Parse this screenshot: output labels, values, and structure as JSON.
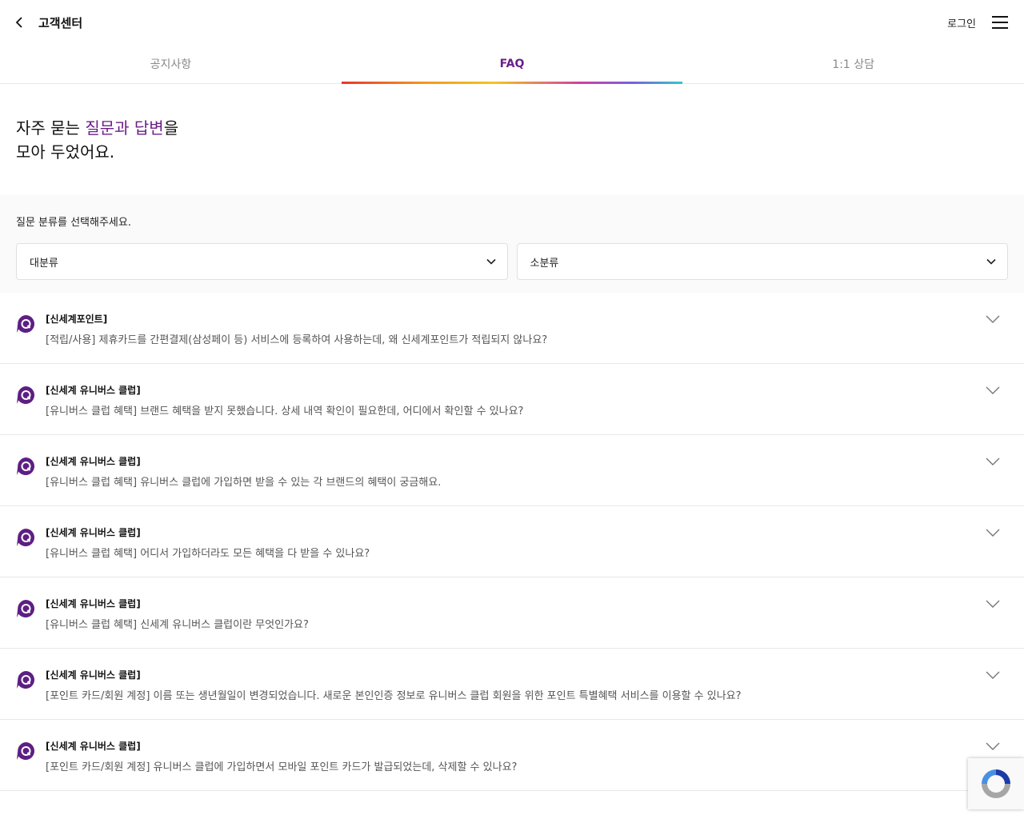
{
  "header": {
    "title": "고객센터",
    "login_label": "로그인"
  },
  "tabs": [
    {
      "label": "공지사항"
    },
    {
      "label": "FAQ"
    },
    {
      "label": "1:1 상담"
    }
  ],
  "intro": {
    "line1_pre": "자주 묻는 ",
    "line1_accent": "질문과 답변",
    "line1_post": "을",
    "line2": "모아 두었어요."
  },
  "filter": {
    "label": "질문 분류를 선택해주세요.",
    "major": "대분류",
    "minor": "소분류"
  },
  "faqs": [
    {
      "category": "[신세계포인트]",
      "question": "[적립/사용] 제휴카드를 간편결제(삼성페이 등) 서비스에 등록하여 사용하는데, 왜 신세계포인트가 적립되지 않나요?"
    },
    {
      "category": "[신세계 유니버스 클럽]",
      "question": "[유니버스 클럽 혜택] 브랜드 혜택을 받지 못했습니다. 상세 내역 확인이 필요한데, 어디에서 확인할 수 있나요?"
    },
    {
      "category": "[신세계 유니버스 클럽]",
      "question": "[유니버스 클럽 혜택] 유니버스 클럽에 가입하면 받을 수 있는 각 브랜드의 혜택이 궁금해요."
    },
    {
      "category": "[신세계 유니버스 클럽]",
      "question": "[유니버스 클럽 혜택] 어디서 가입하더라도 모든 혜택을 다 받을 수 있나요?"
    },
    {
      "category": "[신세계 유니버스 클럽]",
      "question": "[유니버스 클럽 혜택] 신세계 유니버스 클럽이란 무엇인가요?"
    },
    {
      "category": "[신세계 유니버스 클럽]",
      "question": "[포인트 카드/회원 계정] 이름 또는 생년월일이 변경되었습니다. 새로운 본인인증 정보로 유니버스 클럽 회원을 위한 포인트 특별혜택 서비스를 이용할 수 있나요?"
    },
    {
      "category": "[신세계 유니버스 클럽]",
      "question": "[포인트 카드/회원 계정] 유니버스 클럽에 가입하면서 모바일 포인트 카드가 발급되었는데, 삭제할 수 있나요?"
    }
  ],
  "colors": {
    "accent": "#6b1f8a"
  },
  "icons": {
    "back": "chevron-left-icon",
    "menu": "hamburger-menu-icon",
    "q": "q-badge-icon",
    "expand": "chevron-down-icon"
  }
}
